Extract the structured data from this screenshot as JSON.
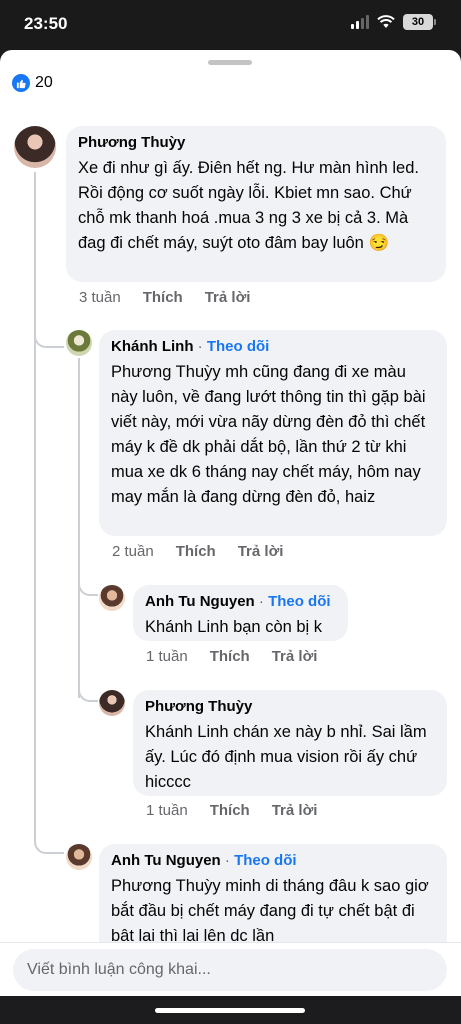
{
  "status": {
    "time": "23:50",
    "battery": "30"
  },
  "reactions": {
    "count": "20"
  },
  "comments": [
    {
      "author": "Phương Thuỳy",
      "text": "Xe đi như gì ấy. Điên hết ng. Hư màn hình led. Rồi động cơ suốt ngày lỗi. Kbiet mn sao. Chứ chỗ mk thanh hoá .mua 3 ng 3 xe bị cả 3. Mà đag đi chết máy, suýt oto đâm bay luôn 😏",
      "time": "3 tuần",
      "like": "Thích",
      "reply": "Trả lời"
    },
    {
      "author": "Khánh Linh",
      "follow": "Theo dõi",
      "text": "Phương Thuỳy mh cũng đang đi xe màu này luôn, về đang lướt thông tin thì gặp bài viết này, mới vừa nãy dừng đèn đỏ thì chết máy k đề dk phải dắt bộ, lần thứ 2 từ khi mua xe dk 6 tháng nay chết máy, hôm nay may mắn là đang dừng đèn đỏ, haiz",
      "time": "2 tuần",
      "like": "Thích",
      "reply": "Trả lời"
    },
    {
      "author": "Anh Tu Nguyen",
      "follow": "Theo dõi",
      "text": "Khánh Linh bạn còn bị k",
      "time": "1 tuần",
      "like": "Thích",
      "reply": "Trả lời"
    },
    {
      "author": "Phương Thuỳy",
      "text": "Khánh Linh chán xe này b nhỉ. Sai lầm ấy. Lúc đó định mua vision rồi ấy chứ hicccc",
      "time": "1 tuần",
      "like": "Thích",
      "reply": "Trả lời"
    },
    {
      "author": "Anh Tu Nguyen",
      "follow": "Theo dõi",
      "text": "Phương Thuỳy minh di tháng đâu k sao giơ bắt đầu bị chết máy đang đi tự chết bật đi bật lại thì lại lên dc lần"
    }
  ],
  "composer": {
    "placeholder": "Viết bình luận công khai..."
  },
  "colors": {
    "accent": "#1877f2",
    "bubble": "#f0f2f5",
    "meta": "#65676b"
  }
}
